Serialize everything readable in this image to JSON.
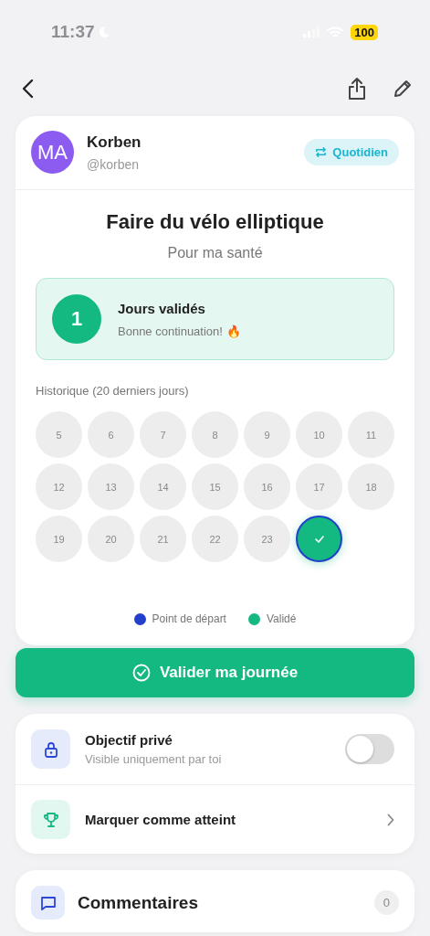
{
  "status_bar": {
    "time": "11:37",
    "battery": "100"
  },
  "owner": {
    "initials": "MA",
    "name": "Korben",
    "handle": "@korben",
    "frequency": "Quotidien"
  },
  "goal": {
    "title": "Faire du vélo elliptique",
    "subtitle": "Pour ma santé"
  },
  "streak": {
    "count": "1",
    "title": "Jours validés",
    "message": "Bonne continuation! 🔥"
  },
  "history": {
    "title": "Historique (20 derniers jours)",
    "days": [
      {
        "label": "5",
        "validated": false,
        "start": false
      },
      {
        "label": "6",
        "validated": false,
        "start": false
      },
      {
        "label": "7",
        "validated": false,
        "start": false
      },
      {
        "label": "8",
        "validated": false,
        "start": false
      },
      {
        "label": "9",
        "validated": false,
        "start": false
      },
      {
        "label": "10",
        "validated": false,
        "start": false
      },
      {
        "label": "11",
        "validated": false,
        "start": false
      },
      {
        "label": "12",
        "validated": false,
        "start": false
      },
      {
        "label": "13",
        "validated": false,
        "start": false
      },
      {
        "label": "14",
        "validated": false,
        "start": false
      },
      {
        "label": "15",
        "validated": false,
        "start": false
      },
      {
        "label": "16",
        "validated": false,
        "start": false
      },
      {
        "label": "17",
        "validated": false,
        "start": false
      },
      {
        "label": "18",
        "validated": false,
        "start": false
      },
      {
        "label": "19",
        "validated": false,
        "start": false
      },
      {
        "label": "20",
        "validated": false,
        "start": false
      },
      {
        "label": "21",
        "validated": false,
        "start": false
      },
      {
        "label": "22",
        "validated": false,
        "start": false
      },
      {
        "label": "23",
        "validated": false,
        "start": false
      },
      {
        "validated": true,
        "start": true
      }
    ],
    "legend": [
      {
        "label": "Point de départ",
        "color": "#2340cc"
      },
      {
        "label": "Validé",
        "color": "#13b980"
      }
    ]
  },
  "validate_button": "Valider ma journée",
  "settings": [
    {
      "kind": "toggle",
      "title": "Objectif privé",
      "subtitle": "Visible uniquement par toi",
      "on": false
    },
    {
      "kind": "link",
      "title": "Marquer comme atteint"
    }
  ],
  "comments": {
    "title": "Commentaires",
    "count": "0"
  }
}
